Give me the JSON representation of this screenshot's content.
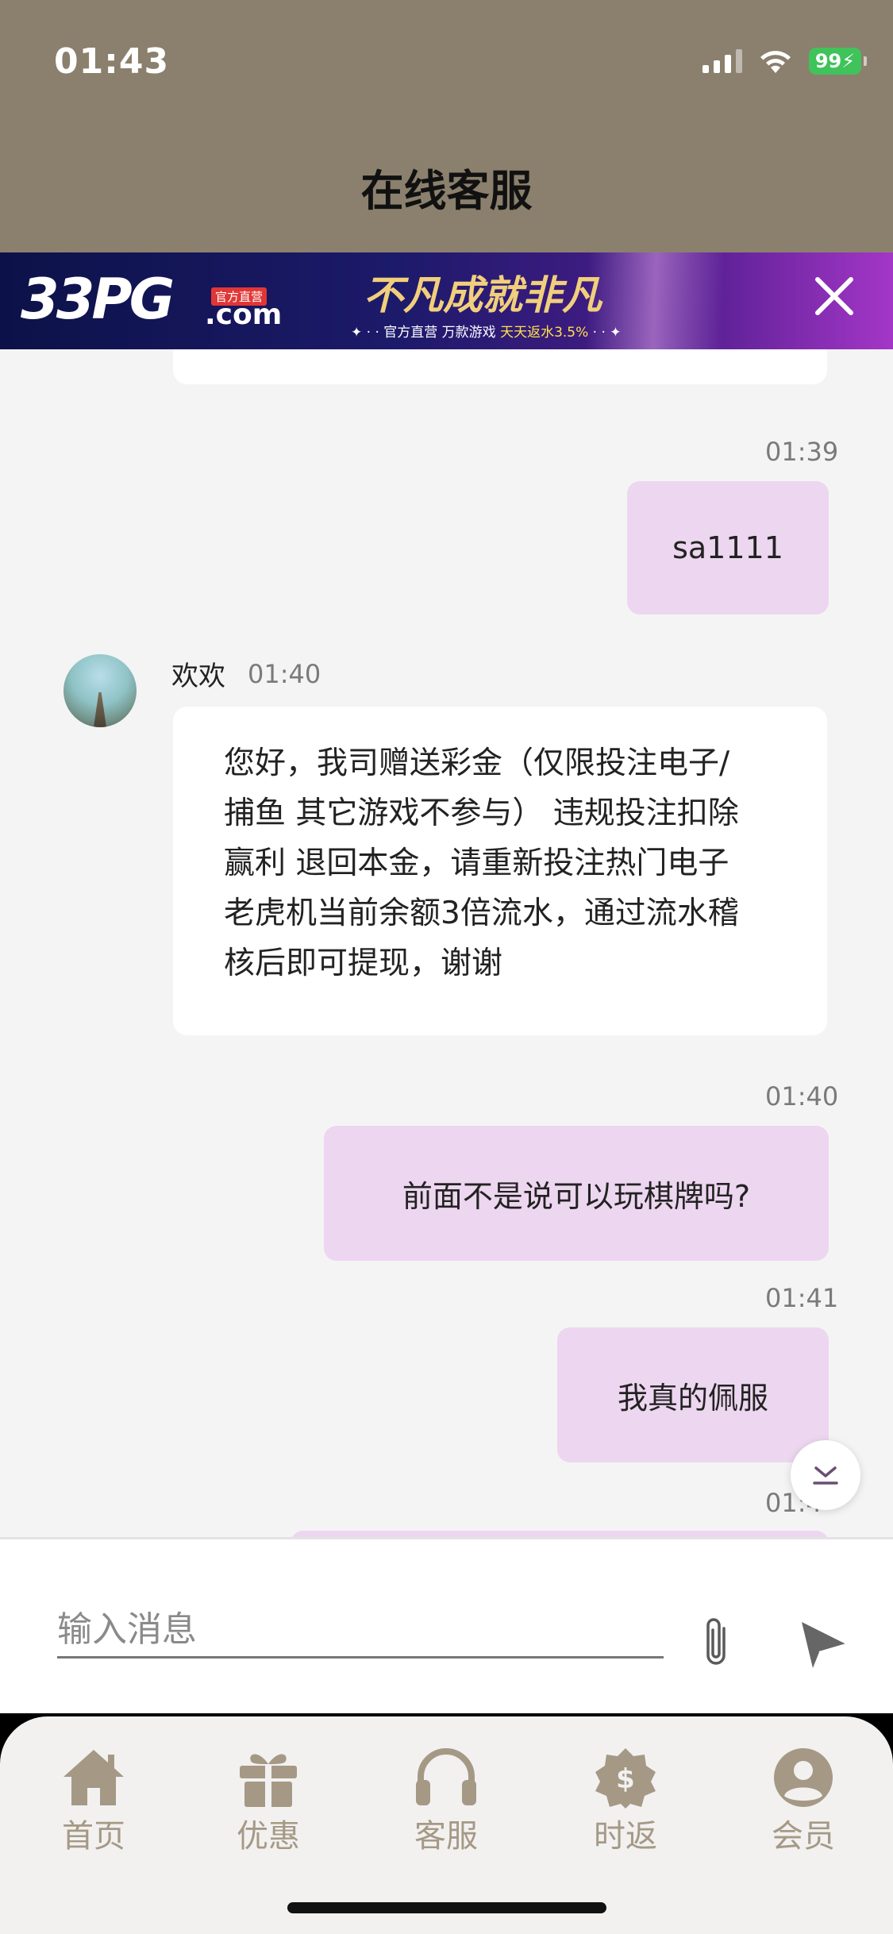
{
  "status_bar": {
    "time": "01:43",
    "battery": "99"
  },
  "header": {
    "title": "在线客服"
  },
  "banner": {
    "logo": "33PG",
    "domain": ".com",
    "tag": "官方直营",
    "slogan": "不凡成就非凡",
    "subtitle_prefix": "✦ · · 官方直营  万款游戏  ",
    "subtitle_highlight": "天天返水3.5%",
    "subtitle_suffix": "  · · ✦"
  },
  "messages": [
    {
      "side": "out",
      "time": "01:39",
      "text": "sa1111"
    },
    {
      "side": "in",
      "sender": "欢欢",
      "time": "01:40",
      "lines": [
        "您好，我司赠送彩金（仅限投注电子/",
        "捕鱼 其它游戏不参与） 违规投注扣除",
        "赢利 退回本金，请重新投注热门电子",
        "老虎机当前余额3倍流水，通过流水稽",
        "核后即可提现，谢谢"
      ]
    },
    {
      "side": "out",
      "time": "01:40",
      "text": "前面不是说可以玩棋牌吗?"
    },
    {
      "side": "out",
      "time": "01:41",
      "text": "我真的佩服"
    },
    {
      "side": "out",
      "time": "01:4"
    }
  ],
  "input": {
    "placeholder": "输入消息"
  },
  "tabs": [
    {
      "label": "首页",
      "icon": "home-icon"
    },
    {
      "label": "优惠",
      "icon": "gift-icon"
    },
    {
      "label": "客服",
      "icon": "headset-icon"
    },
    {
      "label": "时返",
      "icon": "rebate-icon"
    },
    {
      "label": "会员",
      "icon": "user-icon"
    }
  ],
  "colors": {
    "header": "#8b806d",
    "outgoing_bubble": "#edd6ef",
    "tab_icon": "#a59986"
  }
}
